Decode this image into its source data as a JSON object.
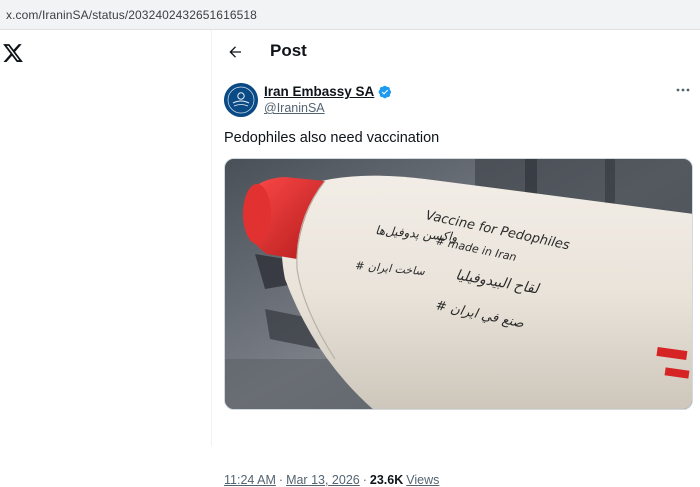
{
  "browser": {
    "url": "x.com/IraninSA/status/2032402432651616518"
  },
  "nav": {
    "logo_icon": "x-logo-icon"
  },
  "header": {
    "back_icon": "arrow-left-icon",
    "title": "Post"
  },
  "tweet": {
    "display_name": "Iran Embassy SA",
    "handle": "@IraninSA",
    "verified_icon": "verified-badge-icon",
    "more_icon": "more-horizontal-icon",
    "text": "Pedophiles also need vaccination",
    "image": {
      "handwriting_line1": "Vaccine for Pedophiles",
      "handwriting_line2": "# made in Iran",
      "handwriting_line3": "واکسن پدوفیل‌ها",
      "handwriting_line4": "لقاح البيدوفيليا",
      "handwriting_line5": "# ساخت ایران",
      "handwriting_line6": "# صنع في ايران"
    },
    "time": "11:24 AM",
    "date": "Mar 13, 2026",
    "views_count": "23.6K",
    "views_label": "Views"
  },
  "colors": {
    "verified": "#1d9bf0",
    "text_primary": "#0f1419",
    "text_secondary": "#536471",
    "missile_nose": "#e02a2a"
  }
}
